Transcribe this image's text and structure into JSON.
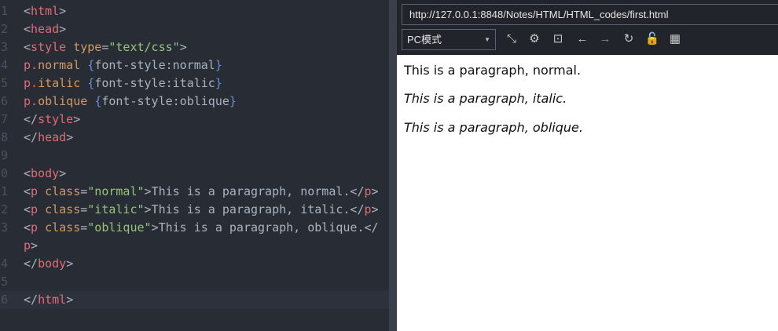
{
  "editor": {
    "lines": [
      {
        "n": "1",
        "t": [
          [
            "p",
            "<"
          ],
          [
            "tag",
            "html"
          ],
          [
            "p",
            ">"
          ]
        ]
      },
      {
        "n": "2",
        "t": [
          [
            "p",
            "<"
          ],
          [
            "tag",
            "head"
          ],
          [
            "p",
            ">"
          ]
        ]
      },
      {
        "n": "3",
        "t": [
          [
            "p",
            "<"
          ],
          [
            "tag",
            "style "
          ],
          [
            "attr",
            "type"
          ],
          [
            "p",
            "="
          ],
          [
            "str",
            "\"text/css\""
          ],
          [
            "p",
            ">"
          ]
        ]
      },
      {
        "n": "4",
        "t": [
          [
            "tag",
            "p."
          ],
          [
            "attr",
            "normal "
          ],
          [
            "br",
            "{"
          ],
          [
            "prop",
            "font-style:normal"
          ],
          [
            "br",
            "}"
          ]
        ]
      },
      {
        "n": "5",
        "t": [
          [
            "tag",
            "p."
          ],
          [
            "attr",
            "italic "
          ],
          [
            "br",
            "{"
          ],
          [
            "prop",
            "font-style:italic"
          ],
          [
            "br",
            "}"
          ]
        ]
      },
      {
        "n": "6",
        "t": [
          [
            "tag",
            "p."
          ],
          [
            "attr",
            "oblique "
          ],
          [
            "br",
            "{"
          ],
          [
            "prop",
            "font-style:oblique"
          ],
          [
            "br",
            "}"
          ]
        ]
      },
      {
        "n": "7",
        "t": [
          [
            "p",
            "</"
          ],
          [
            "tag",
            "style"
          ],
          [
            "p",
            ">"
          ]
        ]
      },
      {
        "n": "8",
        "t": [
          [
            "p",
            "</"
          ],
          [
            "tag",
            "head"
          ],
          [
            "p",
            ">"
          ]
        ]
      },
      {
        "n": "9",
        "t": []
      },
      {
        "n": "0",
        "t": [
          [
            "p",
            "<"
          ],
          [
            "tag",
            "body"
          ],
          [
            "p",
            ">"
          ]
        ]
      },
      {
        "n": "1",
        "t": [
          [
            "p",
            "<"
          ],
          [
            "tag",
            "p "
          ],
          [
            "attr",
            "class"
          ],
          [
            "p",
            "="
          ],
          [
            "str",
            "\"normal\""
          ],
          [
            "p",
            ">This is a paragraph, normal.</"
          ],
          [
            "tag",
            "p"
          ],
          [
            "p",
            ">"
          ]
        ]
      },
      {
        "n": "2",
        "t": [
          [
            "p",
            "<"
          ],
          [
            "tag",
            "p "
          ],
          [
            "attr",
            "class"
          ],
          [
            "p",
            "="
          ],
          [
            "str",
            "\"italic\""
          ],
          [
            "p",
            ">This is a paragraph, italic.</"
          ],
          [
            "tag",
            "p"
          ],
          [
            "p",
            ">"
          ]
        ]
      },
      {
        "n": "3",
        "t": [
          [
            "p",
            "<"
          ],
          [
            "tag",
            "p "
          ],
          [
            "attr",
            "class"
          ],
          [
            "p",
            "="
          ],
          [
            "str",
            "\"oblique\""
          ],
          [
            "p",
            ">This is a paragraph, oblique.</"
          ]
        ]
      },
      {
        "n": "",
        "t": [
          [
            "tag",
            "p"
          ],
          [
            "p",
            ">"
          ]
        ]
      },
      {
        "n": "4",
        "t": [
          [
            "p",
            "</"
          ],
          [
            "tag",
            "body"
          ],
          [
            "p",
            ">"
          ]
        ]
      },
      {
        "n": "5",
        "t": []
      },
      {
        "n": "6",
        "t": [
          [
            "p",
            "</"
          ],
          [
            "tag",
            "html"
          ],
          [
            "p",
            ">"
          ]
        ],
        "current": true
      }
    ]
  },
  "browser": {
    "url": "http://127.0.0.1:8848/Notes/HTML/HTML_codes/first.html",
    "mode": "PC模式",
    "toolbar": [
      {
        "icon": "open-external-icon",
        "glyph": "⤡"
      },
      {
        "icon": "settings-icon",
        "glyph": "⚙"
      },
      {
        "icon": "terminal-icon",
        "glyph": "⊡"
      },
      {
        "icon": "back-icon",
        "glyph": "←"
      },
      {
        "icon": "forward-icon",
        "glyph": "→"
      },
      {
        "icon": "reload-icon",
        "glyph": "↻"
      },
      {
        "icon": "unlock-icon",
        "glyph": "🔓"
      },
      {
        "icon": "qr-code-icon",
        "glyph": "▦"
      }
    ],
    "paragraphs": [
      "This is a paragraph, normal.",
      "This is a paragraph, italic.",
      "This is a paragraph, oblique."
    ]
  }
}
